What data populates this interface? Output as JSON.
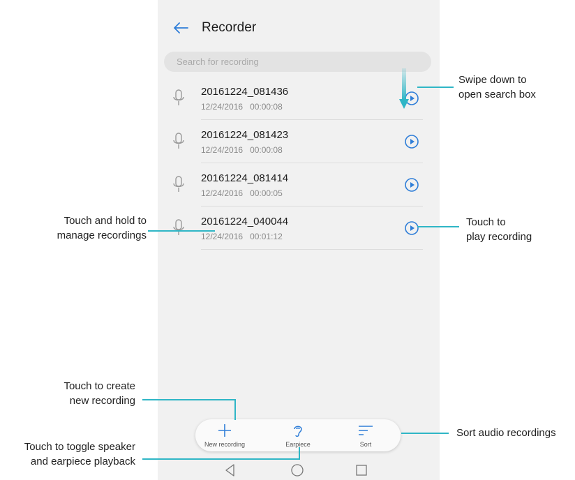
{
  "app": {
    "title": "Recorder"
  },
  "search": {
    "placeholder": "Search for recording"
  },
  "recordings": [
    {
      "name": "20161224_081436",
      "date": "12/24/2016",
      "duration": "00:00:08"
    },
    {
      "name": "20161224_081423",
      "date": "12/24/2016",
      "duration": "00:00:08"
    },
    {
      "name": "20161224_081414",
      "date": "12/24/2016",
      "duration": "00:00:05"
    },
    {
      "name": "20161224_040044",
      "date": "12/24/2016",
      "duration": "00:01:12"
    }
  ],
  "toolbar": {
    "new_label": "New recording",
    "earpiece_label": "Earpiece",
    "sort_label": "Sort"
  },
  "annotations": {
    "swipe": [
      "Swipe down to",
      "open search box"
    ],
    "hold": [
      "Touch and hold to",
      "manage recordings"
    ],
    "play": [
      "Touch to",
      "play recording"
    ],
    "create": [
      "Touch to create",
      "new recording"
    ],
    "toggle": [
      "Touch to toggle speaker",
      "and earpiece playback"
    ],
    "sort": "Sort audio recordings"
  },
  "colors": {
    "accent": "#2f7ed8",
    "callout_line": "#2fb6c6"
  },
  "icons": {
    "back": "arrow-left-icon",
    "mic": "microphone-icon",
    "play": "play-circle-icon",
    "plus": "plus-icon",
    "ear": "ear-icon",
    "sort": "sort-icon"
  }
}
